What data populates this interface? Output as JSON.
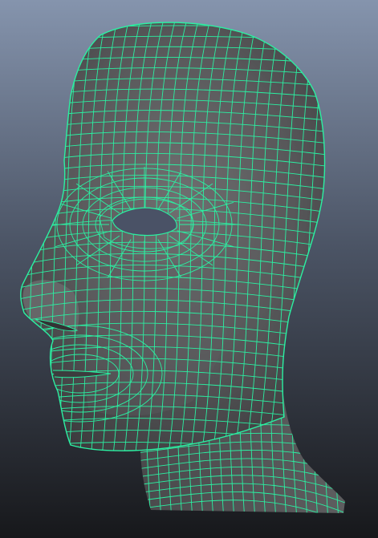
{
  "viewport": {
    "background_top": "#8594ad",
    "background_bottom": "#17181b"
  },
  "model": {
    "shading_light": "#6f6f70",
    "shading_mid": "#58585a",
    "shading_dark": "#3a3a3c",
    "wireframe_color": "#2bf0a2",
    "selection_state": "selected",
    "display_mode": "wireframe-on-shaded"
  }
}
